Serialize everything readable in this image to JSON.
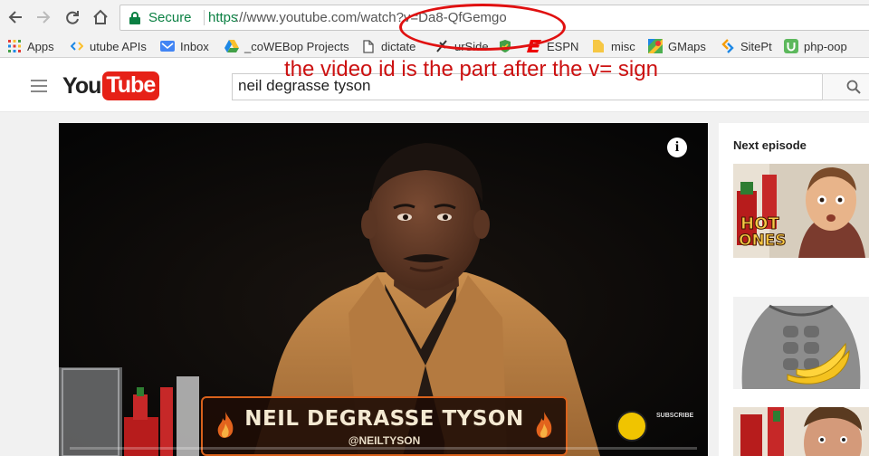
{
  "browser": {
    "secure_label": "Secure",
    "url_prefix": "https",
    "url_rest": "://www.youtube.com/watch?v=Da8-QfGemgo",
    "bookmarks": [
      {
        "label": "Apps",
        "icon": "apps-grid-icon"
      },
      {
        "label": "utube APIs",
        "icon": "code-icon"
      },
      {
        "label": "Inbox",
        "icon": "inbox-icon"
      },
      {
        "label": "_coWEBop Projects",
        "icon": "drive-icon"
      },
      {
        "label": "dictate",
        "icon": "document-icon"
      },
      {
        "label": "urSide",
        "icon": "pin-icon"
      },
      {
        "label": "",
        "icon": "shield-icon"
      },
      {
        "label": "ESPN",
        "icon": "espn-icon"
      },
      {
        "label": "misc",
        "icon": "folder-icon"
      },
      {
        "label": "GMaps",
        "icon": "maps-icon"
      },
      {
        "label": "SitePt",
        "icon": "sitepoint-icon"
      },
      {
        "label": "php-oop",
        "icon": "udemy-icon"
      }
    ]
  },
  "youtube": {
    "logo_you": "You",
    "logo_tube": "Tube",
    "search_value": "neil degrasse tyson"
  },
  "player": {
    "lower_third_name": "NEIL DEGRASSE TYSON",
    "lower_third_handle": "@NEILTYSON",
    "subscribe_label": "SUBSCRIBE",
    "progress": 0.0
  },
  "sidebar": {
    "next_episode_label": "Next episode",
    "thumb1_text_line1": "HOT",
    "thumb1_text_line2": "ONES"
  },
  "annotation": {
    "text": "the video id is the part after the v= sign",
    "color": "#cc1111"
  },
  "colors": {
    "secure_green": "#0b8043",
    "youtube_red": "#e62117",
    "hot_ones_orange": "#d9621c"
  }
}
